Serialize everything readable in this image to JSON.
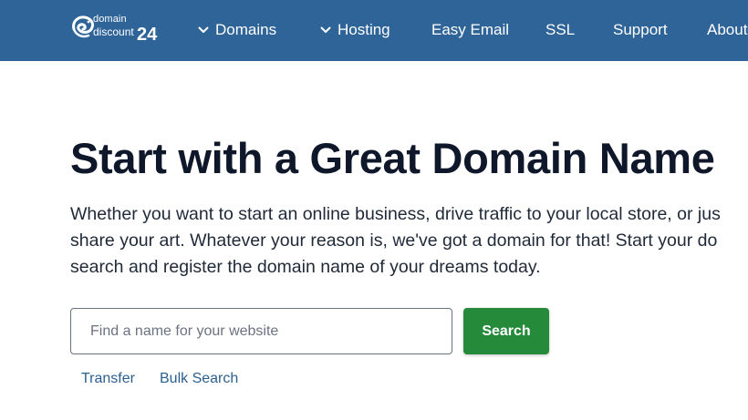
{
  "header": {
    "brand": {
      "top": "domain",
      "bottom": "discount",
      "number": "24"
    },
    "nav": [
      {
        "label": "Domains",
        "icon": "chevron-down-icon"
      },
      {
        "label": "Hosting",
        "icon": "chevron-down-icon"
      },
      {
        "label": "Easy Email"
      },
      {
        "label": "SSL"
      },
      {
        "label": "Support"
      },
      {
        "label": "About"
      }
    ],
    "colors": {
      "bar": "#2f6499",
      "text": "#ffffff"
    }
  },
  "hero": {
    "title": "Start with a Great Domain Name",
    "lines": [
      "Whether you want to start an online business, drive traffic to your local store, or jus",
      "share your art. Whatever your reason is, we've got a domain for that! Start your do",
      "search and register the domain name of your dreams today."
    ]
  },
  "search": {
    "placeholder": "Find a name for your website",
    "value": "",
    "button_label": "Search",
    "button_color": "#258a3a"
  },
  "links": {
    "transfer": "Transfer",
    "bulk_search": "Bulk Search"
  }
}
